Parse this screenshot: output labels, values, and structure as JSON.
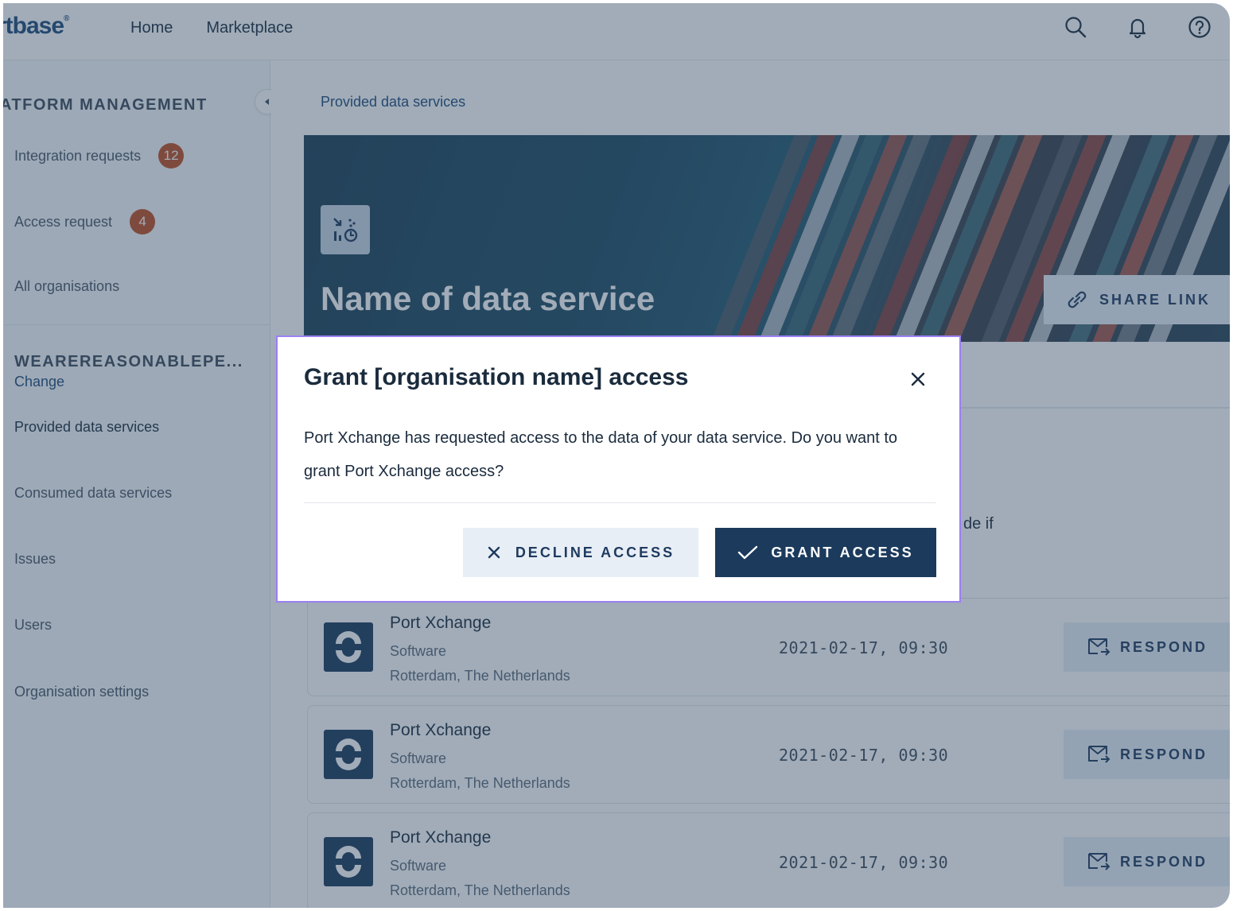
{
  "header": {
    "logo": "rtbase",
    "logo_mark": "®",
    "nav": [
      "Home",
      "Marketplace"
    ],
    "icons": [
      "search-icon",
      "bell-icon",
      "help-icon"
    ]
  },
  "sidebar": {
    "heading": "ATFORM MANAGEMENT",
    "items": [
      {
        "label": "Integration requests",
        "badge": "12"
      },
      {
        "label": "Access request",
        "badge": "4"
      },
      {
        "label": "All organisations"
      }
    ],
    "org": {
      "name": "WEAREREASONABLEPE...",
      "change_label": "Change"
    },
    "org_items": [
      {
        "label": "Provided data services"
      },
      {
        "label": "Consumed data services"
      },
      {
        "label": "Issues"
      },
      {
        "label": "Users"
      },
      {
        "label": "Organisation settings"
      }
    ]
  },
  "main": {
    "breadcrumb": "Provided data services",
    "hero_title": "Name of data service",
    "share_label": "SHARE LINK",
    "partial_text": "de if",
    "rows": [
      {
        "name": "Port Xchange",
        "category": "Software",
        "location": "Rotterdam, The Netherlands",
        "date": "2021-02-17, 09:30",
        "action": "RESPOND"
      },
      {
        "name": "Port Xchange",
        "category": "Software",
        "location": "Rotterdam, The Netherlands",
        "date": "2021-02-17, 09:30",
        "action": "RESPOND"
      },
      {
        "name": "Port Xchange",
        "category": "Software",
        "location": "Rotterdam, The Netherlands",
        "date": "2021-02-17, 09:30",
        "action": "RESPOND"
      }
    ]
  },
  "modal": {
    "title": "Grant [organisation name] access",
    "body": "Port Xchange has requested access to the data of your data service. Do you want to grant Port Xchange access?",
    "decline_label": "DECLINE ACCESS",
    "grant_label": "GRANT ACCESS"
  },
  "colors": {
    "primary": "#1b3a5c",
    "badge": "#c24d21",
    "modal_border": "#9b7ff2",
    "secondary_button": "#e8eef6"
  }
}
